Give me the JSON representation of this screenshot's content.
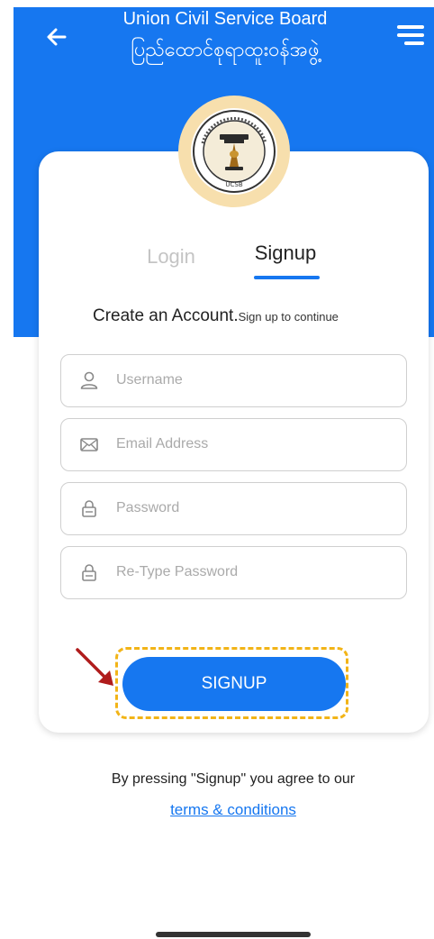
{
  "header": {
    "title_en": "Union Civil Service Board",
    "title_my": "ပြည်ထောင်စုရာထူးဝန်အဖွဲ့",
    "back_icon": "arrow-left-icon",
    "menu_icon": "hamburger-menu-icon"
  },
  "logo": {
    "icon": "ucsb-seal-logo",
    "text": "UCSB"
  },
  "tabs": [
    {
      "label": "Login",
      "active": false
    },
    {
      "label": "Signup",
      "active": true
    }
  ],
  "form": {
    "heading": "Create an Account.",
    "subheading": "Sign up to continue",
    "fields": [
      {
        "placeholder": "Username",
        "value": "",
        "icon": "user-icon"
      },
      {
        "placeholder": "Email Address",
        "value": "",
        "icon": "envelope-icon"
      },
      {
        "placeholder": "Password",
        "value": "",
        "icon": "lock-icon"
      },
      {
        "placeholder": "Re-Type Password",
        "value": "",
        "icon": "lock-icon"
      }
    ],
    "submit_label": "SIGNUP"
  },
  "footer": {
    "agreement_text": "By pressing \"Signup\" you agree to our",
    "terms_link": "terms & conditions"
  },
  "colors": {
    "primary": "#1677f0",
    "highlight": "#f2b417",
    "annotation_arrow": "#b01c1c",
    "logo_ring": "#f7dfad"
  }
}
